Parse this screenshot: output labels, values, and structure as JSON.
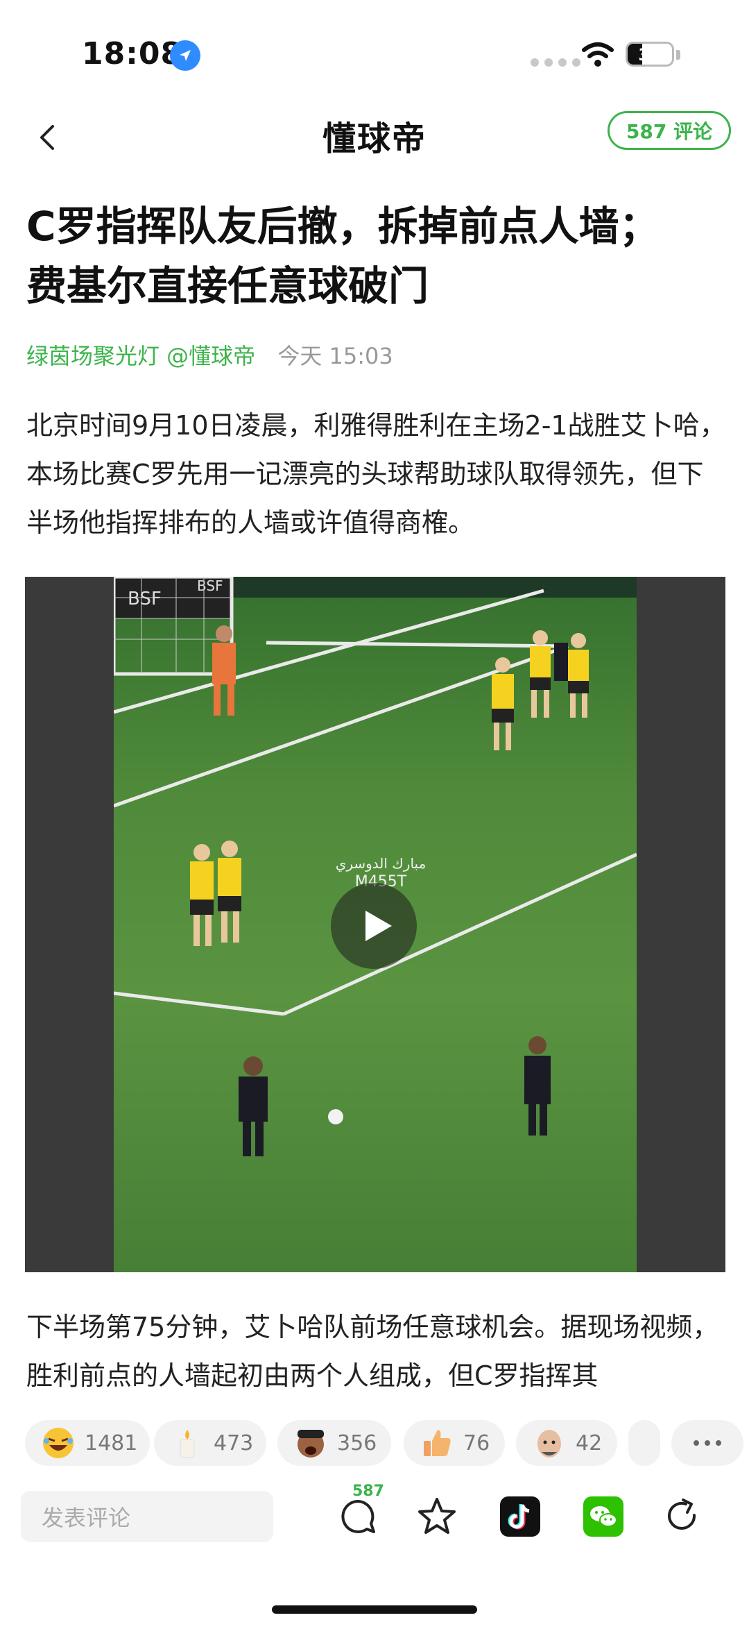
{
  "status": {
    "time": "18:08",
    "battery": "33",
    "battery_level": 0.33
  },
  "nav": {
    "brand": "懂球帝",
    "comment_pill": "587 评论"
  },
  "article": {
    "title_line1": "C罗指挥队友后撤，拆掉前点人墙；",
    "title_line2": "费基尔直接任意球破门",
    "author": "绿茵场聚光灯 @懂球帝",
    "time": "今天 15:03",
    "paragraph1": "北京时间9月10日凌晨，利雅得胜利在主场2-1战胜艾卜哈，本场比赛C罗先用一记漂亮的头球帮助球队取得领先，但下半场他指挥排布的人墙或许值得商榷。",
    "paragraph2": "下半场第75分钟，艾卜哈队前场任意球机会。据现场视频，胜利前点的人墙起初由两个人组成，但C罗指挥其"
  },
  "video": {
    "watermark_line1": "مبارك الدوسري",
    "watermark_line2": "M455T",
    "ad_board": "BSF"
  },
  "reactions": [
    {
      "icon": "laughing-emoji-icon",
      "count": "1481"
    },
    {
      "icon": "candle-icon",
      "count": "473"
    },
    {
      "icon": "shouting-face-icon",
      "count": "356"
    },
    {
      "icon": "thumbs-up-icon",
      "count": "76"
    },
    {
      "icon": "bald-face-icon",
      "count": "42"
    }
  ],
  "bottom_bar": {
    "comment_placeholder": "发表评论",
    "comment_count": "587"
  },
  "colors": {
    "accent": "#3cb44b",
    "pitch": "#4f8a3a",
    "jersey": "#f5d21f"
  }
}
